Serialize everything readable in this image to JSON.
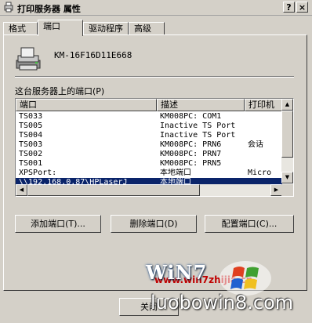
{
  "window": {
    "title": "打印服务器 属性",
    "help_btn": "?",
    "close_btn": "×"
  },
  "tabs": [
    {
      "label": "格式"
    },
    {
      "label": "端口"
    },
    {
      "label": "驱动程序"
    },
    {
      "label": "高级"
    }
  ],
  "server": {
    "name": "KM-16F16D11E668"
  },
  "ports_section": {
    "label": "这台服务器上的端口(P)",
    "columns": [
      "端口",
      "描述",
      "打印机"
    ],
    "rows": [
      {
        "port": "TS033",
        "desc": "KM008PC: COM1",
        "printer": ""
      },
      {
        "port": "TS005",
        "desc": "Inactive TS Port",
        "printer": ""
      },
      {
        "port": "TS004",
        "desc": "Inactive TS Port",
        "printer": ""
      },
      {
        "port": "TS003",
        "desc": "KM008PC: PRN6",
        "printer": "会话"
      },
      {
        "port": "TS002",
        "desc": "KM008PC: PRN7",
        "printer": ""
      },
      {
        "port": "TS001",
        "desc": "KM008PC: PRN5",
        "printer": ""
      },
      {
        "port": "XPSPort:",
        "desc": "本地端口",
        "printer": "Micro"
      },
      {
        "port": "\\\\192.168.0.87\\HPLaserJ",
        "desc": "本地端口",
        "printer": ""
      }
    ],
    "selected_index": 7
  },
  "buttons": {
    "add": "添加端口(T)...",
    "delete": "删除端口(D)",
    "configure": "配置端口(C)..."
  },
  "bottom": {
    "close": "关闭"
  },
  "watermarks": {
    "site1": "www.win7zhijia.cn",
    "win_logo_text": "WiN7",
    "site2": "luobowin8.com"
  },
  "colors": {
    "selection": "#0a246a",
    "face": "#d4d0c8",
    "watermark_red": "#c00000"
  }
}
